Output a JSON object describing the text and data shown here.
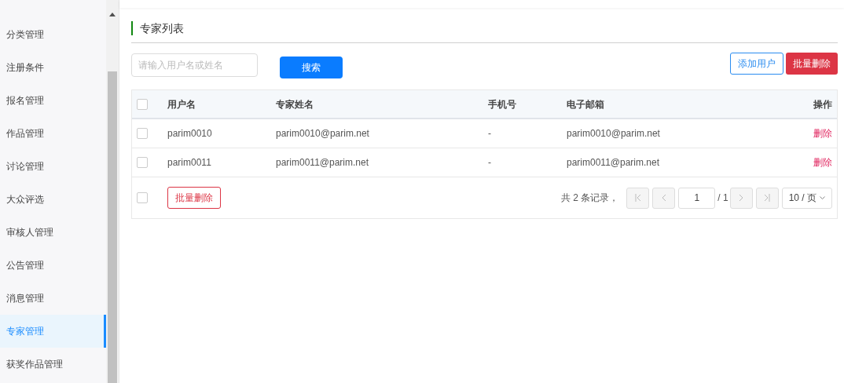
{
  "sidebar": {
    "items": [
      {
        "label": "分类管理",
        "selected": false
      },
      {
        "label": "注册条件",
        "selected": false
      },
      {
        "label": "报名管理",
        "selected": false
      },
      {
        "label": "作品管理",
        "selected": false
      },
      {
        "label": "讨论管理",
        "selected": false
      },
      {
        "label": "大众评选",
        "selected": false
      },
      {
        "label": "审核人管理",
        "selected": false
      },
      {
        "label": "公告管理",
        "selected": false
      },
      {
        "label": "消息管理",
        "selected": false
      },
      {
        "label": "专家管理",
        "selected": true
      },
      {
        "label": "获奖作品管理",
        "selected": false
      }
    ]
  },
  "page_title": "专家列表",
  "search": {
    "placeholder": "请输入用户名或姓名",
    "button": "搜索"
  },
  "toolbar": {
    "add_button": "添加用户",
    "batch_delete_button": "批量删除"
  },
  "table": {
    "select_all_checked": false,
    "columns": [
      "用户名",
      "专家姓名",
      "手机号",
      "电子邮箱",
      "操作"
    ],
    "rows": [
      {
        "checked": false,
        "cells": [
          "parim0010",
          "parim0010@parim.net",
          "-",
          "parim0010@parim.net"
        ],
        "action": "删除"
      },
      {
        "checked": false,
        "cells": [
          "parim0011",
          "parim0011@parim.net",
          "-",
          "parim0011@parim.net"
        ],
        "action": "删除"
      }
    ],
    "footer": {
      "checked": false,
      "batch_delete_button": "批量删除"
    }
  },
  "pagination": {
    "summary": "共 2 条记录，",
    "page": "1",
    "total_pages": "/ 1",
    "page_size": "10 / 页"
  }
}
